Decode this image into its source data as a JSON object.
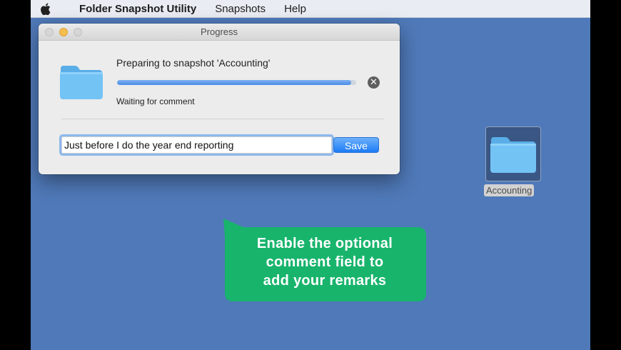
{
  "menubar": {
    "app_name": "Folder Snapshot Utility",
    "items": [
      "Snapshots",
      "Help"
    ]
  },
  "window": {
    "title": "Progress",
    "status_title": "Preparing to snapshot 'Accounting'",
    "progress_fraction": 0.98,
    "status_sub": "Waiting for comment",
    "comment_value": "Just before I do the year end reporting",
    "save_label": "Save"
  },
  "desktop": {
    "folder_label": "Accounting"
  },
  "callout": {
    "lines": [
      "Enable the optional",
      "comment field to",
      "add your remarks"
    ],
    "color": "#18b46c"
  },
  "icons": [
    "apple-icon",
    "folder-icon",
    "cancel-icon"
  ],
  "colors": {
    "desktop": "#4f79b8",
    "accent": "#1d7bf5",
    "folder": "#74c3f5"
  }
}
